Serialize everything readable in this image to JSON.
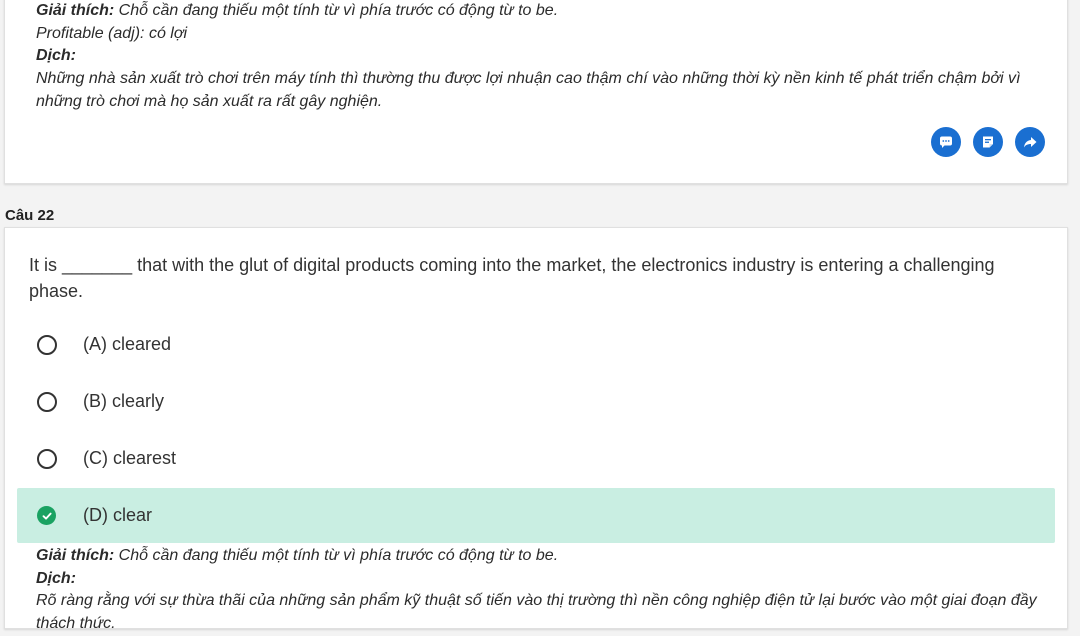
{
  "prev_question": {
    "explanation_label": "Giải thích:",
    "explanation_text": " Chỗ cần đang thiếu một tính từ vì phía trước có động từ to be.",
    "vocab": "Profitable (adj): có lợi",
    "translation_label": "Dịch:",
    "translation_text": "Những nhà sản xuất trò chơi trên máy tính thì thường thu được lợi nhuận cao thậm chí vào những thời kỳ nền kinh tế phát triển chậm bởi vì những trò chơi mà họ sản xuất ra rất gây nghiện."
  },
  "actions": {
    "icons": [
      "comment-icon",
      "note-icon",
      "share-icon"
    ],
    "color": "#1a6fd1"
  },
  "question": {
    "label": "Câu 22",
    "text": "It is _______ that with the glut of digital products coming into the market, the electronics industry is entering a challenging phase.",
    "options": [
      {
        "label": "(A) cleared",
        "correct": false
      },
      {
        "label": "(B) clearly",
        "correct": false
      },
      {
        "label": "(C) clearest",
        "correct": false
      },
      {
        "label": "(D) clear",
        "correct": true
      }
    ],
    "explanation_label": "Giải thích:",
    "explanation_text": " Chỗ cần đang thiếu một tính từ vì phía trước có động từ to be.",
    "translation_label": "Dịch:",
    "translation_text": "Rõ ràng rằng với sự thừa thãi của những sản phẩm kỹ thuật số tiến vào thị trường thì nền công nghiệp điện tử lại bước vào một giai đoạn đầy thách thức."
  },
  "colors": {
    "correct_bg": "#c9eee2",
    "correct_check": "#1aa262"
  }
}
